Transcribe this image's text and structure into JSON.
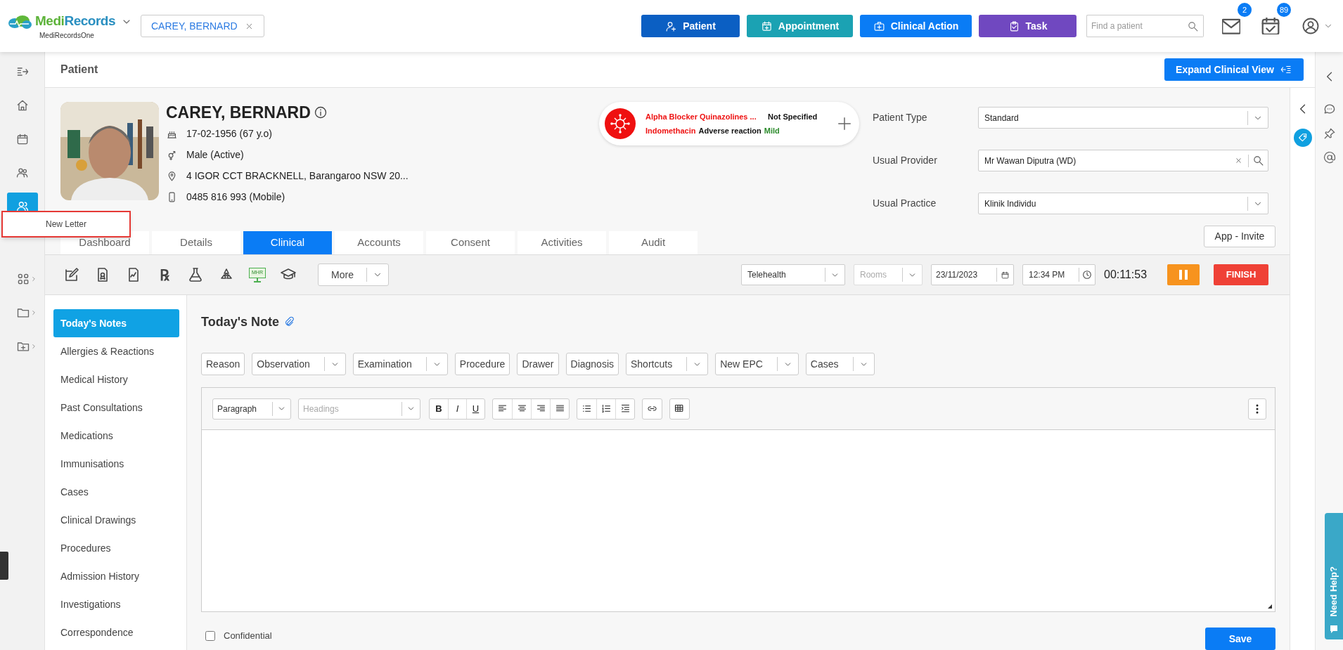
{
  "app": {
    "brand_part_1": "Medi",
    "brand_part_2": "Records",
    "subtitle": "MediRecordsOne"
  },
  "open_patient_tab": {
    "label": "CAREY, BERNARD"
  },
  "top_actions": [
    {
      "kind": "user-plus",
      "label": "Patient",
      "color": "#0b5fc3"
    },
    {
      "kind": "calendar-plus",
      "label": "Appointment",
      "color": "#1ba2b3"
    },
    {
      "kind": "medkit",
      "label": "Clinical Action",
      "color": "#0a7cf5"
    },
    {
      "kind": "clipboard",
      "label": "Task",
      "color": "#7048c0"
    }
  ],
  "search": {
    "placeholder": "Find a patient"
  },
  "notifications": [
    {
      "kind": "mail",
      "count": "2"
    },
    {
      "kind": "calendar-check",
      "count": "89"
    }
  ],
  "sidebar": {
    "items": [
      {
        "kind": "collapse",
        "selected": false,
        "submenu": false
      },
      {
        "kind": "home",
        "selected": false,
        "submenu": false
      },
      {
        "kind": "calendar",
        "selected": false,
        "submenu": false
      },
      {
        "kind": "people",
        "selected": false,
        "submenu": false
      },
      {
        "kind": "patients",
        "selected": true,
        "submenu": false
      },
      {
        "kind": "apps",
        "selected": false,
        "submenu": true
      },
      {
        "kind": "folder",
        "selected": false,
        "submenu": true
      },
      {
        "kind": "folder-plus",
        "selected": false,
        "submenu": true
      }
    ]
  },
  "flyout_menu": {
    "items": [
      {
        "label": "New Letter"
      }
    ]
  },
  "page": {
    "title": "Patient",
    "expand_button": "Expand Clinical View"
  },
  "patient": {
    "name": "CAREY, BERNARD",
    "details": [
      {
        "kind": "birthday",
        "text": "17-02-1956 (67 y.o)"
      },
      {
        "kind": "gender",
        "text": "Male (Active)"
      },
      {
        "kind": "address",
        "text": "4 IGOR CCT BRACKNELL, Barangaroo NSW 20..."
      },
      {
        "kind": "phone",
        "text": "0485 816 993 (Mobile)"
      }
    ]
  },
  "allergies": [
    {
      "substance": "Alpha Blocker Quinazolines ...",
      "reaction": "Not Specified"
    },
    {
      "substance": "Indomethacin",
      "reaction": "Adverse reaction",
      "severity": "Mild"
    }
  ],
  "fields": [
    {
      "kind": "select",
      "label": "Patient Type",
      "value": "Standard"
    },
    {
      "kind": "search",
      "label": "Usual Provider",
      "value": "Mr Wawan Diputra (WD)"
    },
    {
      "kind": "select",
      "label": "Usual Practice",
      "value": "Klinik Individu"
    }
  ],
  "invite_button": "App - Invite",
  "tabs": [
    {
      "label": "Dashboard",
      "selected": false
    },
    {
      "label": "Details",
      "selected": false
    },
    {
      "label": "Clinical",
      "selected": true
    },
    {
      "label": "Accounts",
      "selected": false
    },
    {
      "label": "Consent",
      "selected": false
    },
    {
      "label": "Activities",
      "selected": false
    },
    {
      "label": "Audit",
      "selected": false
    }
  ],
  "tools": [
    {
      "kind": "edit"
    },
    {
      "kind": "certificate"
    },
    {
      "kind": "chart-doc"
    },
    {
      "kind": "rx",
      "glyph": "℞"
    },
    {
      "kind": "flask"
    },
    {
      "kind": "radiation"
    },
    {
      "kind": "mhr",
      "label": "MHR"
    },
    {
      "kind": "graduation"
    }
  ],
  "more_button": "More",
  "visit": {
    "type": "Telehealth",
    "rooms_placeholder": "Rooms",
    "date": "23/11/2023",
    "time": "12:34 PM",
    "timer": "00:11:53",
    "finish": "FINISH"
  },
  "clinical_nav": [
    {
      "label": "Today's Notes",
      "selected": true
    },
    {
      "label": "Allergies & Reactions",
      "selected": false
    },
    {
      "label": "Medical History",
      "selected": false
    },
    {
      "label": "Past Consultations",
      "selected": false
    },
    {
      "label": "Medications",
      "selected": false
    },
    {
      "label": "Immunisations",
      "selected": false
    },
    {
      "label": "Cases",
      "selected": false
    },
    {
      "label": "Clinical Drawings",
      "selected": false
    },
    {
      "label": "Procedures",
      "selected": false
    },
    {
      "label": "Admission History",
      "selected": false
    },
    {
      "label": "Investigations",
      "selected": false
    },
    {
      "label": "Correspondence",
      "selected": false
    }
  ],
  "note": {
    "title": "Today's Note",
    "quick_buttons": [
      {
        "label": "Reason",
        "dropdown": false
      },
      {
        "label": "Observation",
        "dropdown": true
      },
      {
        "label": "Examination",
        "dropdown": true
      },
      {
        "label": "Procedure",
        "dropdown": false
      },
      {
        "label": "Drawer",
        "dropdown": false
      },
      {
        "label": "Diagnosis",
        "dropdown": false
      },
      {
        "label": "Shortcuts",
        "dropdown": true
      },
      {
        "label": "New EPC",
        "dropdown": true
      },
      {
        "label": "Cases",
        "dropdown": true
      }
    ],
    "editor": {
      "block_style": "Paragraph",
      "headings_placeholder": "Headings",
      "format_groups": [
        [
          {
            "kind": "bold",
            "label": "B"
          },
          {
            "kind": "italic",
            "label": "I"
          },
          {
            "kind": "underline",
            "label": "U"
          }
        ],
        [
          {
            "kind": "align-left"
          },
          {
            "kind": "align-center"
          },
          {
            "kind": "align-right"
          },
          {
            "kind": "align-justify"
          }
        ],
        [
          {
            "kind": "list-bullet"
          },
          {
            "kind": "list-number"
          },
          {
            "kind": "indent"
          }
        ],
        [
          {
            "kind": "link"
          }
        ],
        [
          {
            "kind": "table"
          }
        ]
      ]
    },
    "confidential": {
      "label": "Confidential",
      "checked": false
    },
    "save": "Save"
  },
  "help_tab": {
    "label": "Need Help?"
  }
}
